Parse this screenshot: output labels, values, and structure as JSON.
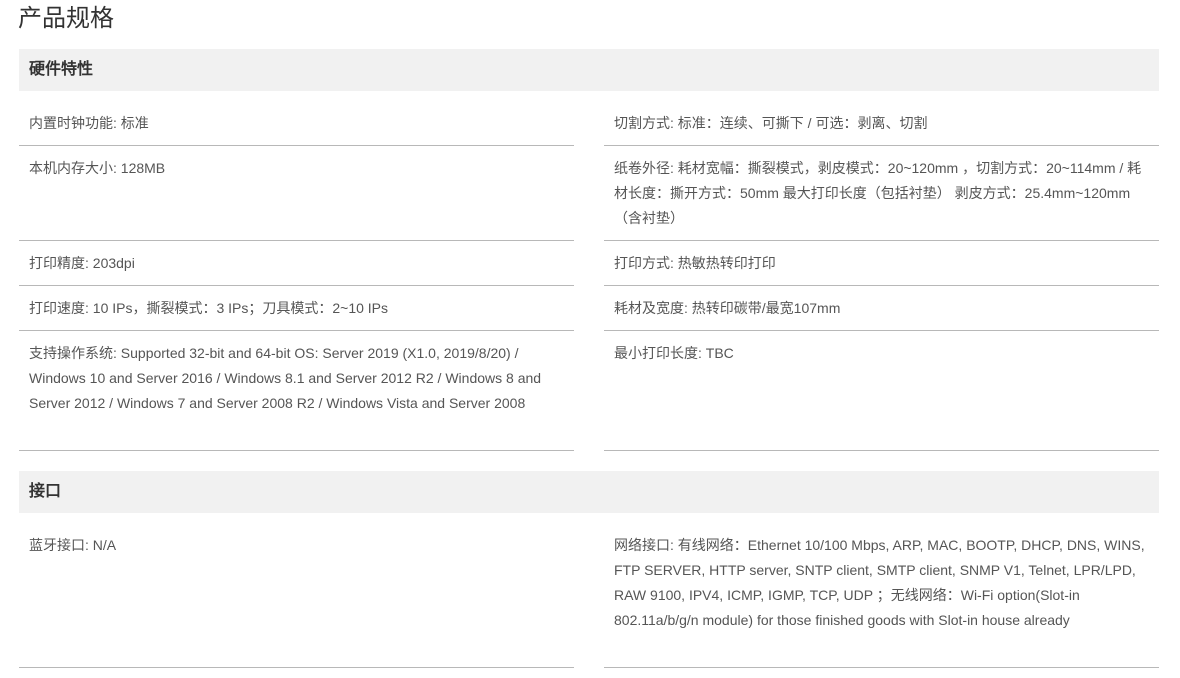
{
  "page_title": "产品规格",
  "sections": [
    {
      "title": "硬件特性",
      "left": [
        "内置时钟功能: 标准",
        "本机内存大小: 128MB",
        "打印精度: 203dpi",
        "打印速度: 10 IPs，撕裂模式：3 IPs；刀具模式：2~10 IPs",
        "支持操作系统: Supported 32-bit and 64-bit OS: Server 2019 (X1.0, 2019/8/20) / Windows 10 and Server 2016 / Windows 8.1 and Server 2012 R2 / Windows 8 and Server 2012 / Windows 7 and Server 2008 R2 / Windows Vista and Server 2008"
      ],
      "right": [
        "切割方式: 标准：连续、可撕下 / 可选：剥离、切割",
        "纸卷外径: 耗材宽幅：撕裂模式，剥皮模式：20~120mm ，切割方式：20~114mm / 耗材长度：撕开方式：50mm 最大打印长度（包括衬垫） 剥皮方式：25.4mm~120mm（含衬垫）",
        "打印方式: 热敏热转印打印",
        "耗材及宽度: 热转印碳带/最宽107mm",
        "最小打印长度: TBC"
      ]
    },
    {
      "title": "接口",
      "left": [
        "蓝牙接口: N/A"
      ],
      "right": [
        "网络接口: 有线网络：Ethernet 10/100 Mbps, ARP, MAC, BOOTP, DHCP, DNS, WINS, FTP SERVER, HTTP server, SNTP client, SMTP client, SNMP V1, Telnet, LPR/LPD, RAW 9100, IPV4, ICMP, IGMP, TCP, UDP ；无线网络：Wi-Fi option(Slot-in 802.11a/b/g/n module) for those finished goods with Slot-in house already"
      ]
    }
  ]
}
